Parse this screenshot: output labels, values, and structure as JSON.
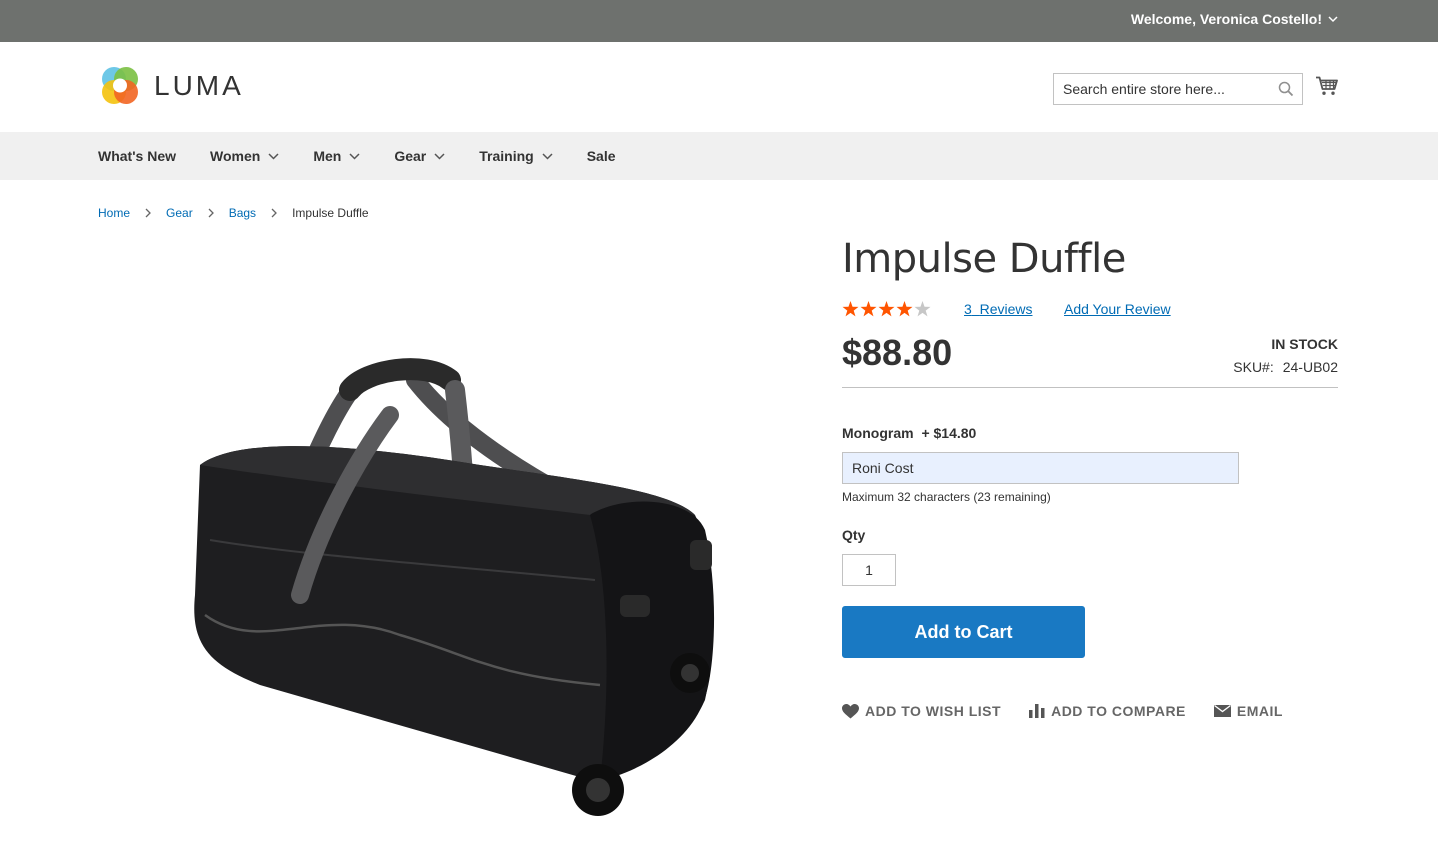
{
  "top_panel": {
    "welcome": "Welcome, Veronica Costello!"
  },
  "header": {
    "logo_text": "LUMA",
    "search": {
      "placeholder": "Search entire store here..."
    }
  },
  "nav": {
    "items": [
      {
        "label": "What's New",
        "has_dropdown": false
      },
      {
        "label": "Women",
        "has_dropdown": true
      },
      {
        "label": "Men",
        "has_dropdown": true
      },
      {
        "label": "Gear",
        "has_dropdown": true
      },
      {
        "label": "Training",
        "has_dropdown": true
      },
      {
        "label": "Sale",
        "has_dropdown": false
      }
    ]
  },
  "breadcrumb": {
    "items": [
      "Home",
      "Gear",
      "Bags"
    ],
    "current": "Impulse Duffle"
  },
  "product": {
    "title": "Impulse Duffle",
    "rating_fraction": 0.8,
    "reviews_count": "3",
    "reviews_label": "Reviews",
    "add_review": "Add Your Review",
    "price": "$88.80",
    "stock": "IN STOCK",
    "sku_label": "SKU#:",
    "sku": "24-UB02",
    "monogram_label": "Monogram",
    "monogram_price": "+ $14.80",
    "monogram_value": "Roni Cost",
    "monogram_note": "Maximum 32 characters (23 remaining)",
    "qty_label": "Qty",
    "qty_value": "1",
    "add_to_cart": "Add to Cart",
    "actions": {
      "wishlist": "ADD TO WISH LIST",
      "compare": "ADD TO COMPARE",
      "email": "EMAIL"
    }
  },
  "colors": {
    "top_panel": "#6e716e",
    "link": "#006bb4",
    "button": "#1979c3",
    "star_filled": "#ff5501",
    "star_empty": "#c7c7c7",
    "nav_bg": "#f0f0f0"
  }
}
